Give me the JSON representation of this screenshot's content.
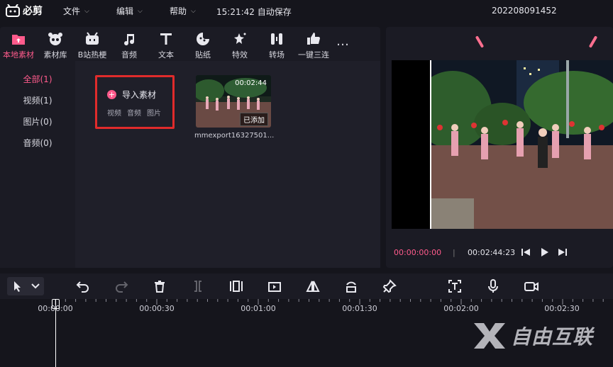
{
  "app": {
    "logo_text": "必剪",
    "menus": [
      {
        "label": "文件"
      },
      {
        "label": "编辑"
      },
      {
        "label": "帮助"
      }
    ],
    "autosave": "15:21:42 自动保存",
    "project_name": "202208091452"
  },
  "media_tabs": [
    {
      "label": "本地素材",
      "icon": "upload-folder-icon",
      "active": true
    },
    {
      "label": "素材库",
      "icon": "panda-icon"
    },
    {
      "label": "B站热梗",
      "icon": "tv-icon"
    },
    {
      "label": "音频",
      "icon": "music-note-icon"
    },
    {
      "label": "文本",
      "icon": "text-t-icon"
    },
    {
      "label": "贴纸",
      "icon": "sticker-icon"
    },
    {
      "label": "特效",
      "icon": "sparkle-icon"
    },
    {
      "label": "转场",
      "icon": "transition-icon"
    },
    {
      "label": "一键三连",
      "icon": "thumbs-up-icon"
    },
    {
      "label": "…",
      "icon": "more-icon"
    }
  ],
  "sidebar": {
    "items": [
      {
        "label": "全部(1)",
        "active": true
      },
      {
        "label": "视频(1)"
      },
      {
        "label": "图片(0)"
      },
      {
        "label": "音频(0)"
      }
    ]
  },
  "import": {
    "label": "导入素材",
    "types": [
      "视频",
      "音频",
      "图片"
    ]
  },
  "media_item": {
    "duration": "00:02:44",
    "status": "已添加",
    "name": "mmexport16327501..."
  },
  "player": {
    "current_time": "00:00:00:00",
    "separator": "|",
    "total_time": "00:02:44:23"
  },
  "timeline": {
    "ruler_labels": [
      "00:00:00",
      "00:00:30",
      "00:01:00",
      "00:01:30",
      "00:02:00",
      "00:02:30"
    ]
  },
  "watermark": {
    "text": "自由互联"
  },
  "colors": {
    "accent": "#ff5b8c",
    "highlight_box": "#e02b2b",
    "panel": "#1b1b24",
    "background": "#15151c"
  }
}
